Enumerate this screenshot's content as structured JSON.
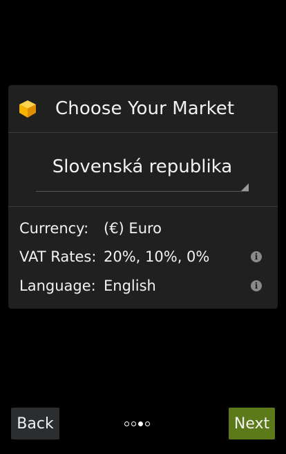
{
  "dialog": {
    "title": "Choose Your Market",
    "icon": "cube-icon",
    "icon_colors": {
      "top": "#ffd54f",
      "left": "#f5b400",
      "right": "#e08e00"
    },
    "market": {
      "selected": "Slovenská republika"
    },
    "info": [
      {
        "label": "Currency:",
        "value": "(€) Euro",
        "has_info_icon": false
      },
      {
        "label": "VAT Rates:",
        "value": "20%, 10%, 0%",
        "has_info_icon": true
      },
      {
        "label": "Language:",
        "value": "English",
        "has_info_icon": true
      }
    ],
    "info_icon_glyph": "i"
  },
  "footer": {
    "back_label": "Back",
    "next_label": "Next",
    "pager": {
      "total": 4,
      "active_index": 2
    }
  },
  "colors": {
    "background": "#000000",
    "dialog_bg": "#202020",
    "next_button": "#5d7a1a",
    "back_button": "#2a2e30"
  }
}
